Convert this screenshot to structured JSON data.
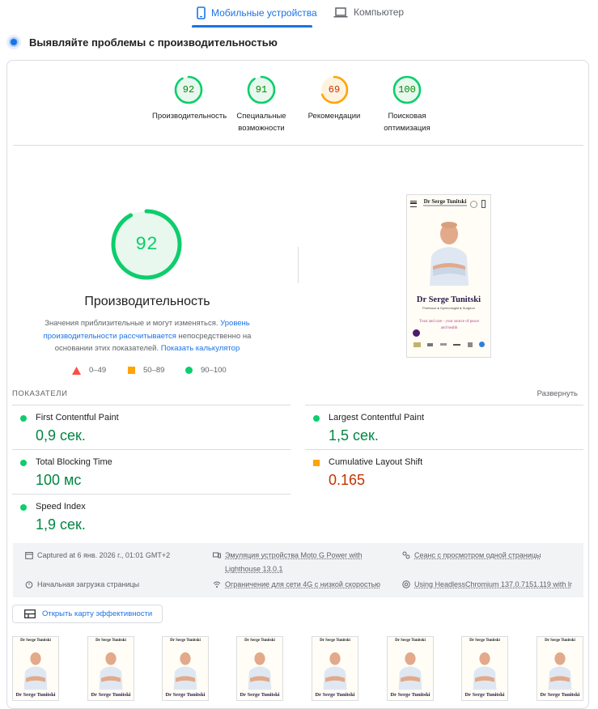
{
  "tabs": [
    {
      "label": "Мобильные устройства",
      "icon": "smartphone-icon"
    },
    {
      "label": "Компьютер",
      "icon": "laptop-icon"
    }
  ],
  "heading": "Выявляйте проблемы с производительностью",
  "categories": [
    {
      "score": "92",
      "label_line1": "Производительность",
      "label_line2": "",
      "level": 92,
      "color": "#0cce6b",
      "text_color": "#008800"
    },
    {
      "score": "91",
      "label_line1": "Специальные",
      "label_line2": "возможности",
      "level": 91,
      "color": "#0cce6b",
      "text_color": "#008800"
    },
    {
      "score": "69",
      "label_line1": "Рекомендации",
      "label_line2": "",
      "level": 69,
      "color": "#ffa400",
      "text_color": "#c33300"
    },
    {
      "score": "100",
      "label_line1": "Поисковая",
      "label_line2": "оптимизация",
      "level": 100,
      "color": "#0cce6b",
      "text_color": "#008800"
    }
  ],
  "performance": {
    "score": "92",
    "level": 92,
    "title": "Производительность",
    "desc_text1": "Значения приблизительные и могут изменяться.",
    "desc_link1": "Уровень производительности рассчитывается",
    "desc_text2": "непосредственно на основании этих показателей.",
    "desc_link2": "Показать калькулятор"
  },
  "legend": [
    {
      "range": "0–49",
      "shape": "triangle",
      "color": "#ff4e42"
    },
    {
      "range": "50–89",
      "shape": "square",
      "color": "#ffa400"
    },
    {
      "range": "90–100",
      "shape": "circle",
      "color": "#0cce6b"
    }
  ],
  "screenshot": {
    "site_name": "Dr Serge Tunitski",
    "subtitle": "Professor ● Gynecologist ● Surgeon",
    "tagline": "Trust and care - your source of peace and health",
    "header_name": "Dr Serge Tunitski"
  },
  "metrics_section": {
    "title": "ПОКАЗАТЕЛИ",
    "expand": "Развернуть"
  },
  "metrics": [
    {
      "name": "First Contentful Paint",
      "value": "0,9 сек.",
      "status": "good"
    },
    {
      "name": "Largest Contentful Paint",
      "value": "1,5 сек.",
      "status": "good"
    },
    {
      "name": "Total Blocking Time",
      "value": "100 мс",
      "status": "good"
    },
    {
      "name": "Cumulative Layout Shift",
      "value": "0.165",
      "status": "average"
    },
    {
      "name": "Speed Index",
      "value": "1,9 сек.",
      "status": "good"
    }
  ],
  "info": {
    "captured": "Captured at 6 янв. 2026 г., 01:01 GMT+2",
    "emulation": "Эмуляция устройства Moto G Power with",
    "emulation2": "Lighthouse 13.0.1",
    "session": "Сеанс с просмотром одной страницы",
    "load": "Начальная загрузка страницы",
    "throttle": "Ограничение для сети 4G с низкой скоростью",
    "browser": "Using HeadlessChromium 137.0.7151.119 with lr"
  },
  "treemap_button": "Открыть карту эффективности",
  "filmstrip_label": "Dr Serge Tunitski"
}
